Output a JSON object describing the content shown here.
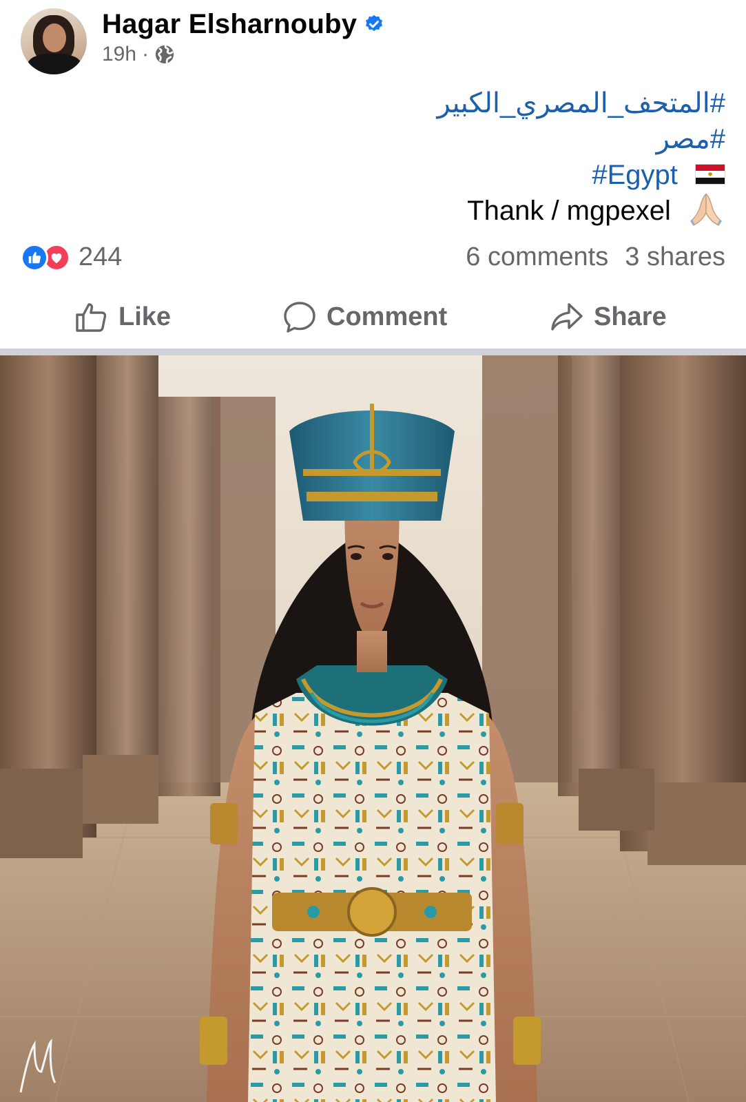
{
  "post": {
    "author": "Hagar Elsharnouby",
    "time": "19h",
    "separator": "·",
    "hashtags": [
      "#المتحف_المصري_الكبير",
      "#مصر",
      "#Egypt"
    ],
    "caption": "Thank / mgpexel",
    "emojis": {
      "flag": "egypt-flag-icon",
      "hands": "folded-hands-icon"
    },
    "watermark": "Mgdn"
  },
  "stats": {
    "reaction_count": "244",
    "comments": "6 comments",
    "shares": "3 shares"
  },
  "actions": {
    "like": "Like",
    "comment": "Comment",
    "share": "Share"
  },
  "colors": {
    "hashtag": "#1b5fad",
    "secondary_text": "#65676b",
    "like_blue": "#1877f2",
    "love_red": "#f33e58"
  }
}
